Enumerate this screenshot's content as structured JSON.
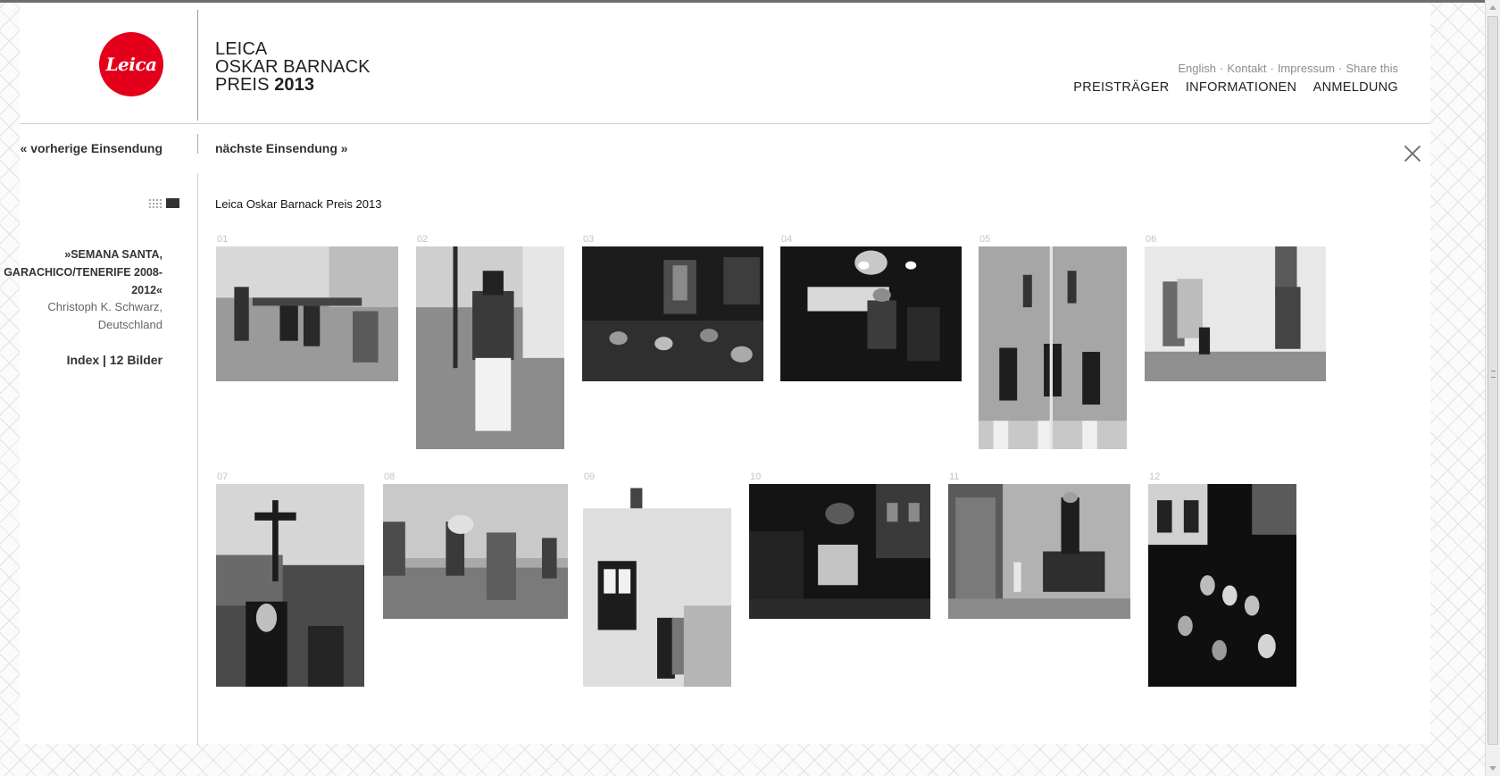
{
  "header": {
    "logo_text": "Leica",
    "title_lines": [
      "LEICA",
      "OSKAR BARNACK",
      "PREIS"
    ],
    "title_year": "2013",
    "util_links": [
      "English",
      "Kontakt",
      "Impressum",
      "Share this"
    ],
    "util_separator": "·",
    "nav": [
      "PREISTRÄGER",
      "INFORMATIONEN",
      "ANMELDUNG"
    ]
  },
  "navigation": {
    "prev_label": "« vorherige Einsendung",
    "next_label": "nächste Einsendung »"
  },
  "sidebar": {
    "series_title": "»SEMANA SANTA, GARACHICO/TENERIFE 2008-2012«",
    "author": "Christoph K. Schwarz, Deutschland",
    "index_label": "Index | 12 Bilder"
  },
  "gallery": {
    "title": "Leica Oskar Barnack Preis 2013",
    "images": [
      {
        "number": "01",
        "tone": "mid"
      },
      {
        "number": "02",
        "tone": "mid"
      },
      {
        "number": "03",
        "tone": "dark"
      },
      {
        "number": "04",
        "tone": "dark"
      },
      {
        "number": "05",
        "tone": "light"
      },
      {
        "number": "06",
        "tone": "light"
      },
      {
        "number": "07",
        "tone": "mid"
      },
      {
        "number": "08",
        "tone": "mid"
      },
      {
        "number": "09",
        "tone": "light"
      },
      {
        "number": "10",
        "tone": "dark"
      },
      {
        "number": "11",
        "tone": "mid"
      },
      {
        "number": "12",
        "tone": "dark"
      }
    ]
  },
  "colors": {
    "brand_red": "#e4001b",
    "text": "#333333",
    "muted": "#8d8d8d"
  }
}
